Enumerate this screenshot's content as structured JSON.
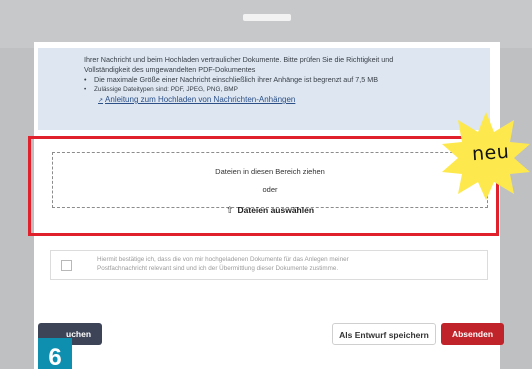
{
  "info": {
    "line1": "Ihrer Nachricht und beim Hochladen vertraulicher Dokumente. Bitte prüfen Sie die Richtigkeit und",
    "line2": "Vollständigkeit des umgewandelten PDF-Dokumentes",
    "bullet1": "Die maximale Größe einer Nachricht einschließlich ihrer Anhänge ist begrenzt auf 7,5 MB",
    "bullet2": "Zulässige Dateitypen sind: PDF, JPEG, PNG, BMP",
    "link": "Anleitung zum Hochladen von Nachrichten-Anhängen"
  },
  "dropzone": {
    "hint": "Dateien in diesen Bereich ziehen",
    "or": "oder",
    "select_label": "Dateien auswählen"
  },
  "badge": {
    "label": "neu",
    "color": "#fde94d"
  },
  "consent": {
    "line1": "Hiermit bestätige ich, dass die von mir hochgeladenen Dokumente für das Anlegen meiner",
    "line2": "Postfachnachricht relevant sind und ich der Übermittlung dieser Dokumente zustimme."
  },
  "footer": {
    "back_label": "uchen",
    "draft_label": "Als Entwurf speichern",
    "send_label": "Absenden"
  },
  "step": {
    "number": "6",
    "color": "#0f8fb0"
  },
  "colors": {
    "highlight_frame": "#e0202a",
    "send": "#c0232a",
    "back": "#3d4457"
  }
}
